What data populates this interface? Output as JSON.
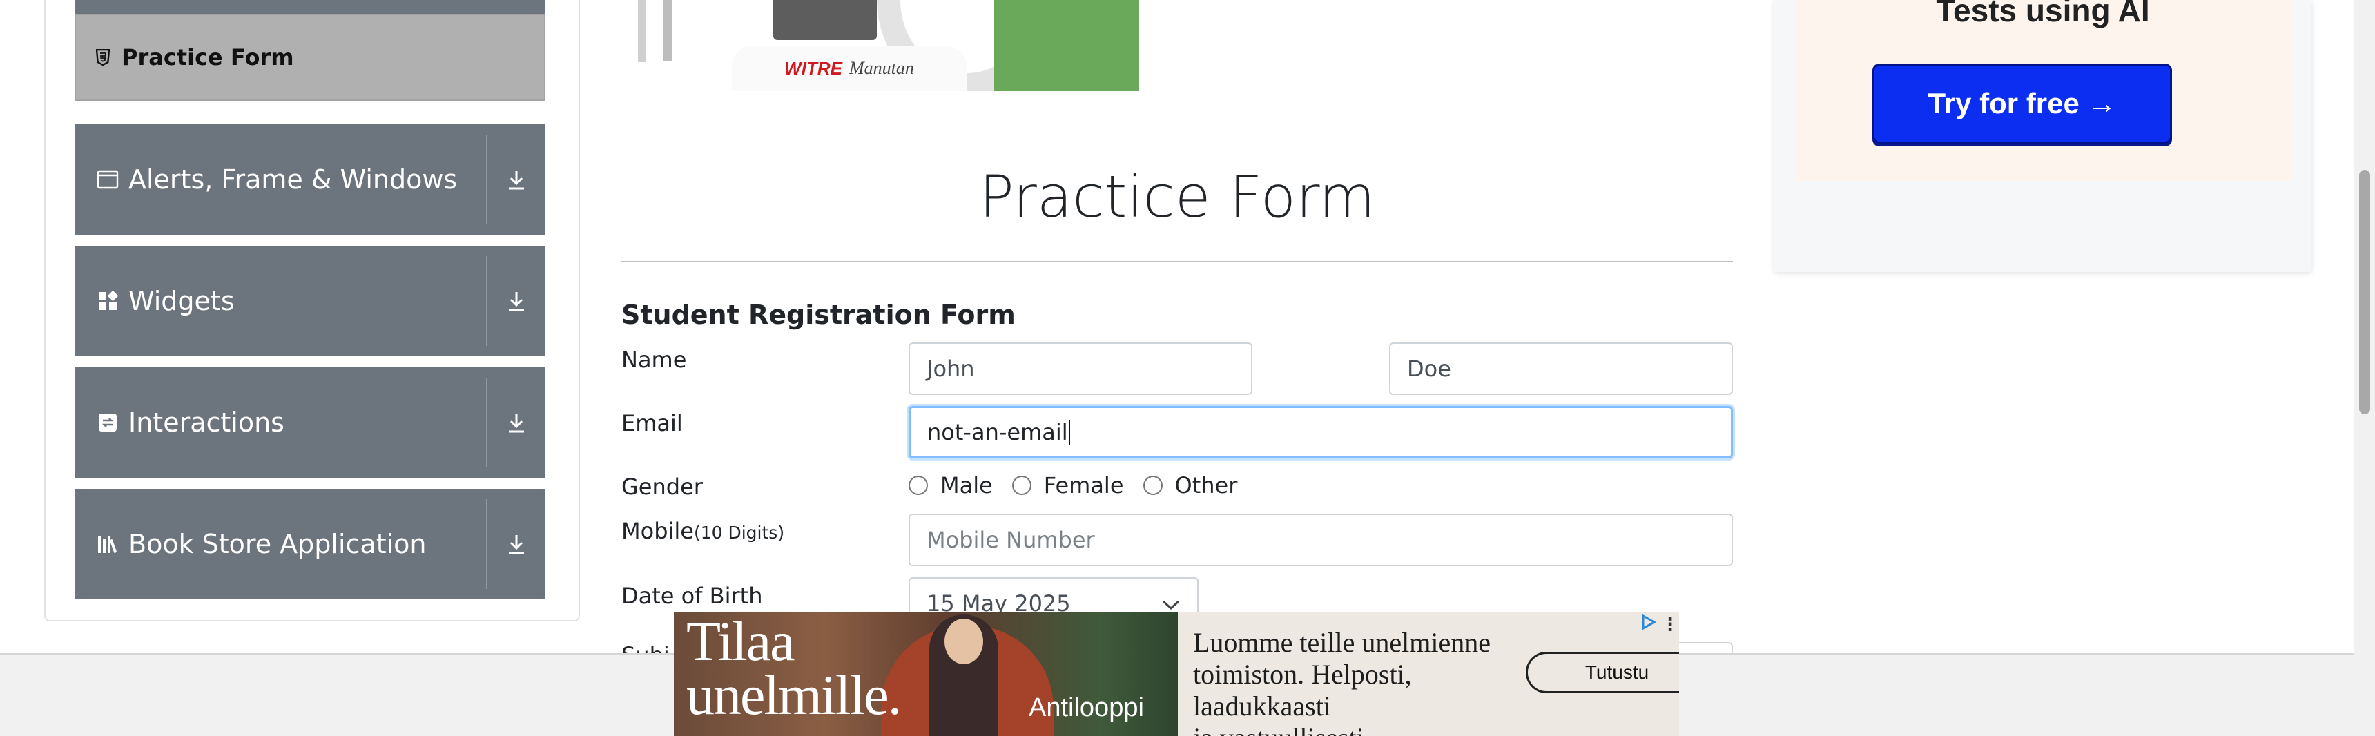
{
  "sidebar": {
    "active_item": {
      "label": "Practice Form",
      "icon": "html5-icon"
    },
    "groups": [
      {
        "label": "Alerts, Frame & Windows",
        "icon": "window-icon"
      },
      {
        "label": "Widgets",
        "icon": "widgets-icon"
      },
      {
        "label": "Interactions",
        "icon": "interactions-icon"
      },
      {
        "label": "Book Store Application",
        "icon": "books-icon"
      }
    ]
  },
  "top_banner": {
    "logo_primary": "WITRE",
    "logo_secondary": "Manutan"
  },
  "main": {
    "page_title": "Practice Form",
    "form_heading": "Student Registration Form",
    "name": {
      "label": "Name",
      "first_value": "John",
      "last_value": "Doe"
    },
    "email": {
      "label": "Email",
      "value": "not-an-email"
    },
    "gender": {
      "label": "Gender",
      "options": [
        "Male",
        "Female",
        "Other"
      ]
    },
    "mobile": {
      "label": "Mobile",
      "hint": "(10 Digits)",
      "placeholder": "Mobile Number"
    },
    "dob": {
      "label": "Date of Birth",
      "value": "15 May 2025"
    },
    "subjects": {
      "label": "Subj"
    }
  },
  "right_ad": {
    "text": "Tests using AI",
    "button": "Try for free →",
    "accent": "#0b2ef0"
  },
  "bottom_ad": {
    "headline_line1": "Tilaa",
    "headline_line2": "unelmille.",
    "brand": "Antilooppi",
    "copy_line1": "Luomme teille unelmienne",
    "copy_line2": "toimiston. Helposti, laadukkaasti",
    "copy_line3": "ja vastuullisesti.",
    "cta": "Tutustu"
  },
  "colors": {
    "sidebar_group": "#6c757d",
    "active_item": "#b0b0b0",
    "focus_border": "#80bdff"
  }
}
